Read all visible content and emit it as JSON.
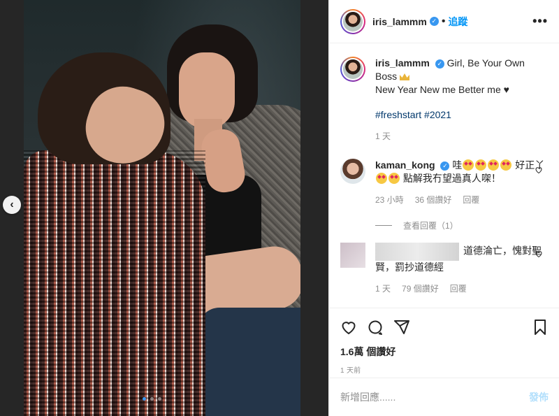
{
  "post": {
    "username": "iris_lammm",
    "follow_label": "追蹤",
    "more_icon": "more-options-icon"
  },
  "caption": {
    "username": "iris_lammm",
    "line1": "Girl, Be Your Own Boss",
    "line2": "New Year New me Better me ♥",
    "hashtags": "#freshstart #2021",
    "age": "1 天"
  },
  "comments": [
    {
      "username": "kaman_kong",
      "text_a": "哇",
      "text_b": "好正丫",
      "text_c": "點解我冇望過真人㗎！",
      "age": "23 小時",
      "likes": "36 個讚好",
      "reply": "回覆",
      "view_replies": "查看回覆（1）"
    },
    {
      "text": "道德淪亡，愧對聖賢，罰抄道德經",
      "age": "1 天",
      "likes": "79 個讚好",
      "reply": "回覆"
    }
  ],
  "footer": {
    "likes": "1.6萬 個讚好",
    "time": "1 天前",
    "add_comment_placeholder": "新增回應......",
    "post_label": "發佈"
  },
  "colors": {
    "link": "#0095f6",
    "hashtag": "#00376b",
    "muted": "#8e8e8e"
  }
}
